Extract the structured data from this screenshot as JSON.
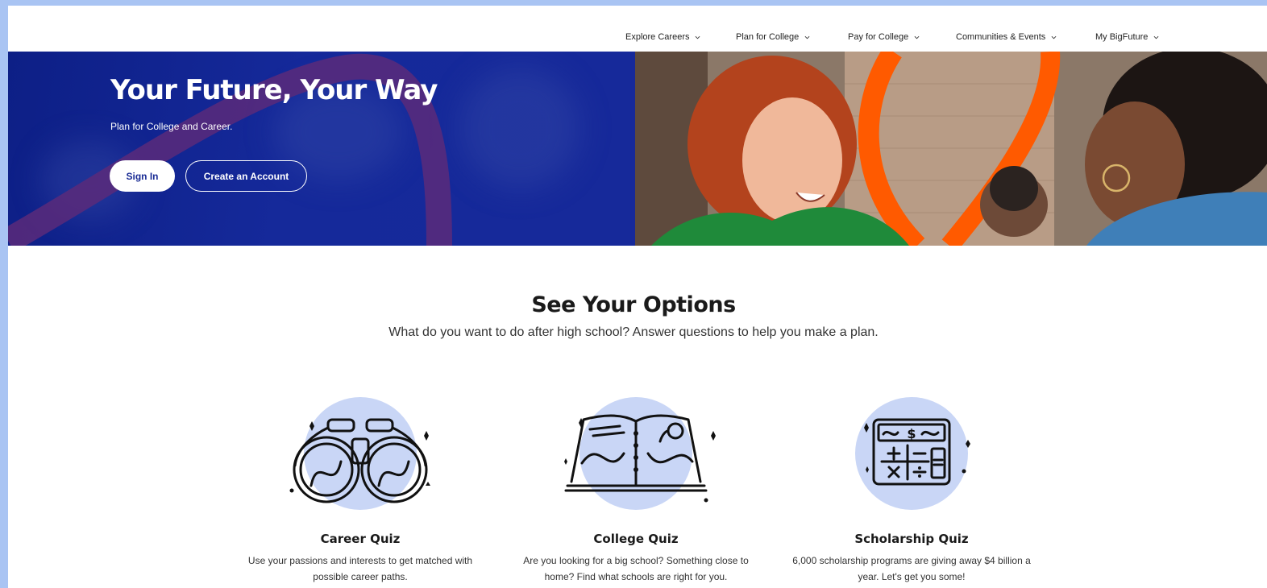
{
  "nav": {
    "items": [
      {
        "label": "Explore Careers"
      },
      {
        "label": "Plan for College"
      },
      {
        "label": "Pay for College"
      },
      {
        "label": "Communities & Events"
      },
      {
        "label": "My BigFuture"
      }
    ]
  },
  "hero": {
    "title": "Your Future, Your Way",
    "subtitle": "Plan for College and Career.",
    "sign_in_label": "Sign In",
    "create_account_label": "Create an Account"
  },
  "options": {
    "title": "See Your Options",
    "subtitle": "What do you want to do after high school? Answer questions to help you make a plan.",
    "cards": [
      {
        "title": "Career Quiz",
        "description": "Use your passions and interests to get matched with possible career paths.",
        "icon": "binoculars-icon"
      },
      {
        "title": "College Quiz",
        "description": "Are you looking for a big school? Something close to home? Find what schools are right for you.",
        "icon": "open-book-map-icon"
      },
      {
        "title": "Scholarship Quiz",
        "description": "6,000 scholarship programs are giving away $4 billion a year. Let's get you some!",
        "icon": "calculator-icon"
      }
    ]
  },
  "colors": {
    "hero_blue": "#15299a",
    "accent_orange": "#ff5a00",
    "illustration_circle": "#c9d6f6"
  }
}
